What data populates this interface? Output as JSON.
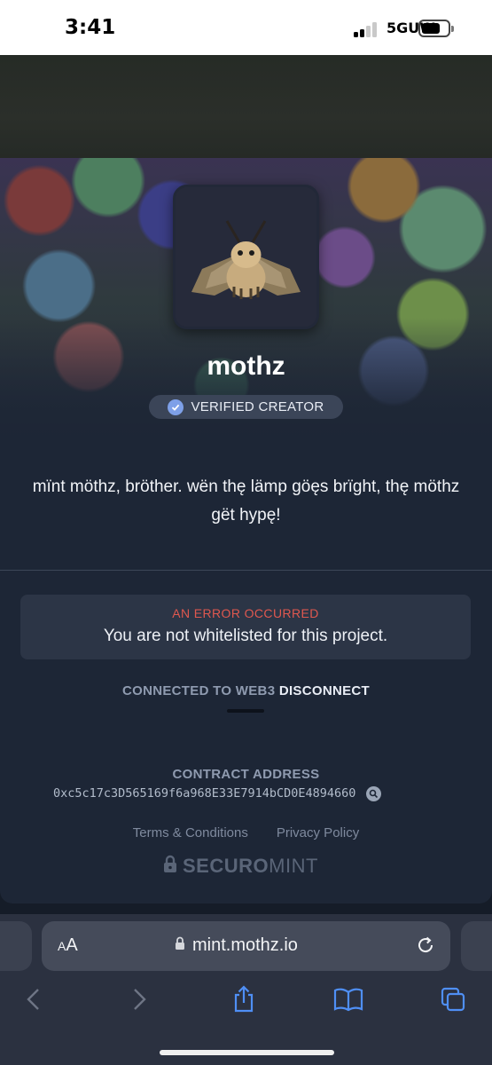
{
  "status_bar": {
    "time": "3:41",
    "network": "5GUW"
  },
  "project": {
    "name": "mothz",
    "badge_label": "VERIFIED CREATOR",
    "description": "mïnt möthz, bröther. wën thę lämp göęs brïght, thę möthz gët hypę!"
  },
  "error": {
    "title": "AN ERROR OCCURRED",
    "message": "You are not whitelisted for this project."
  },
  "connection": {
    "status_label": "CONNECTED TO WEB3",
    "disconnect_label": "DISCONNECT"
  },
  "contract": {
    "label": "CONTRACT ADDRESS",
    "address": "0xc5c17c3D565169f6a968E33E7914bCD0E4894660"
  },
  "footer": {
    "terms_label": "Terms & Conditions",
    "privacy_label": "Privacy Policy",
    "brand_bold": "SECURO",
    "brand_light": "MINT"
  },
  "browser": {
    "aa_small": "A",
    "aa_large": "A",
    "url": "mint.mothz.io"
  },
  "colors": {
    "error": "#e0584f",
    "verified": "#7ea0e8",
    "card_bg": "#1d2636"
  },
  "icons": [
    "verified-check-icon",
    "copy-search-icon",
    "lock-icon",
    "reload-icon",
    "back-icon",
    "forward-icon",
    "share-icon",
    "bookmarks-icon",
    "tabs-icon"
  ]
}
